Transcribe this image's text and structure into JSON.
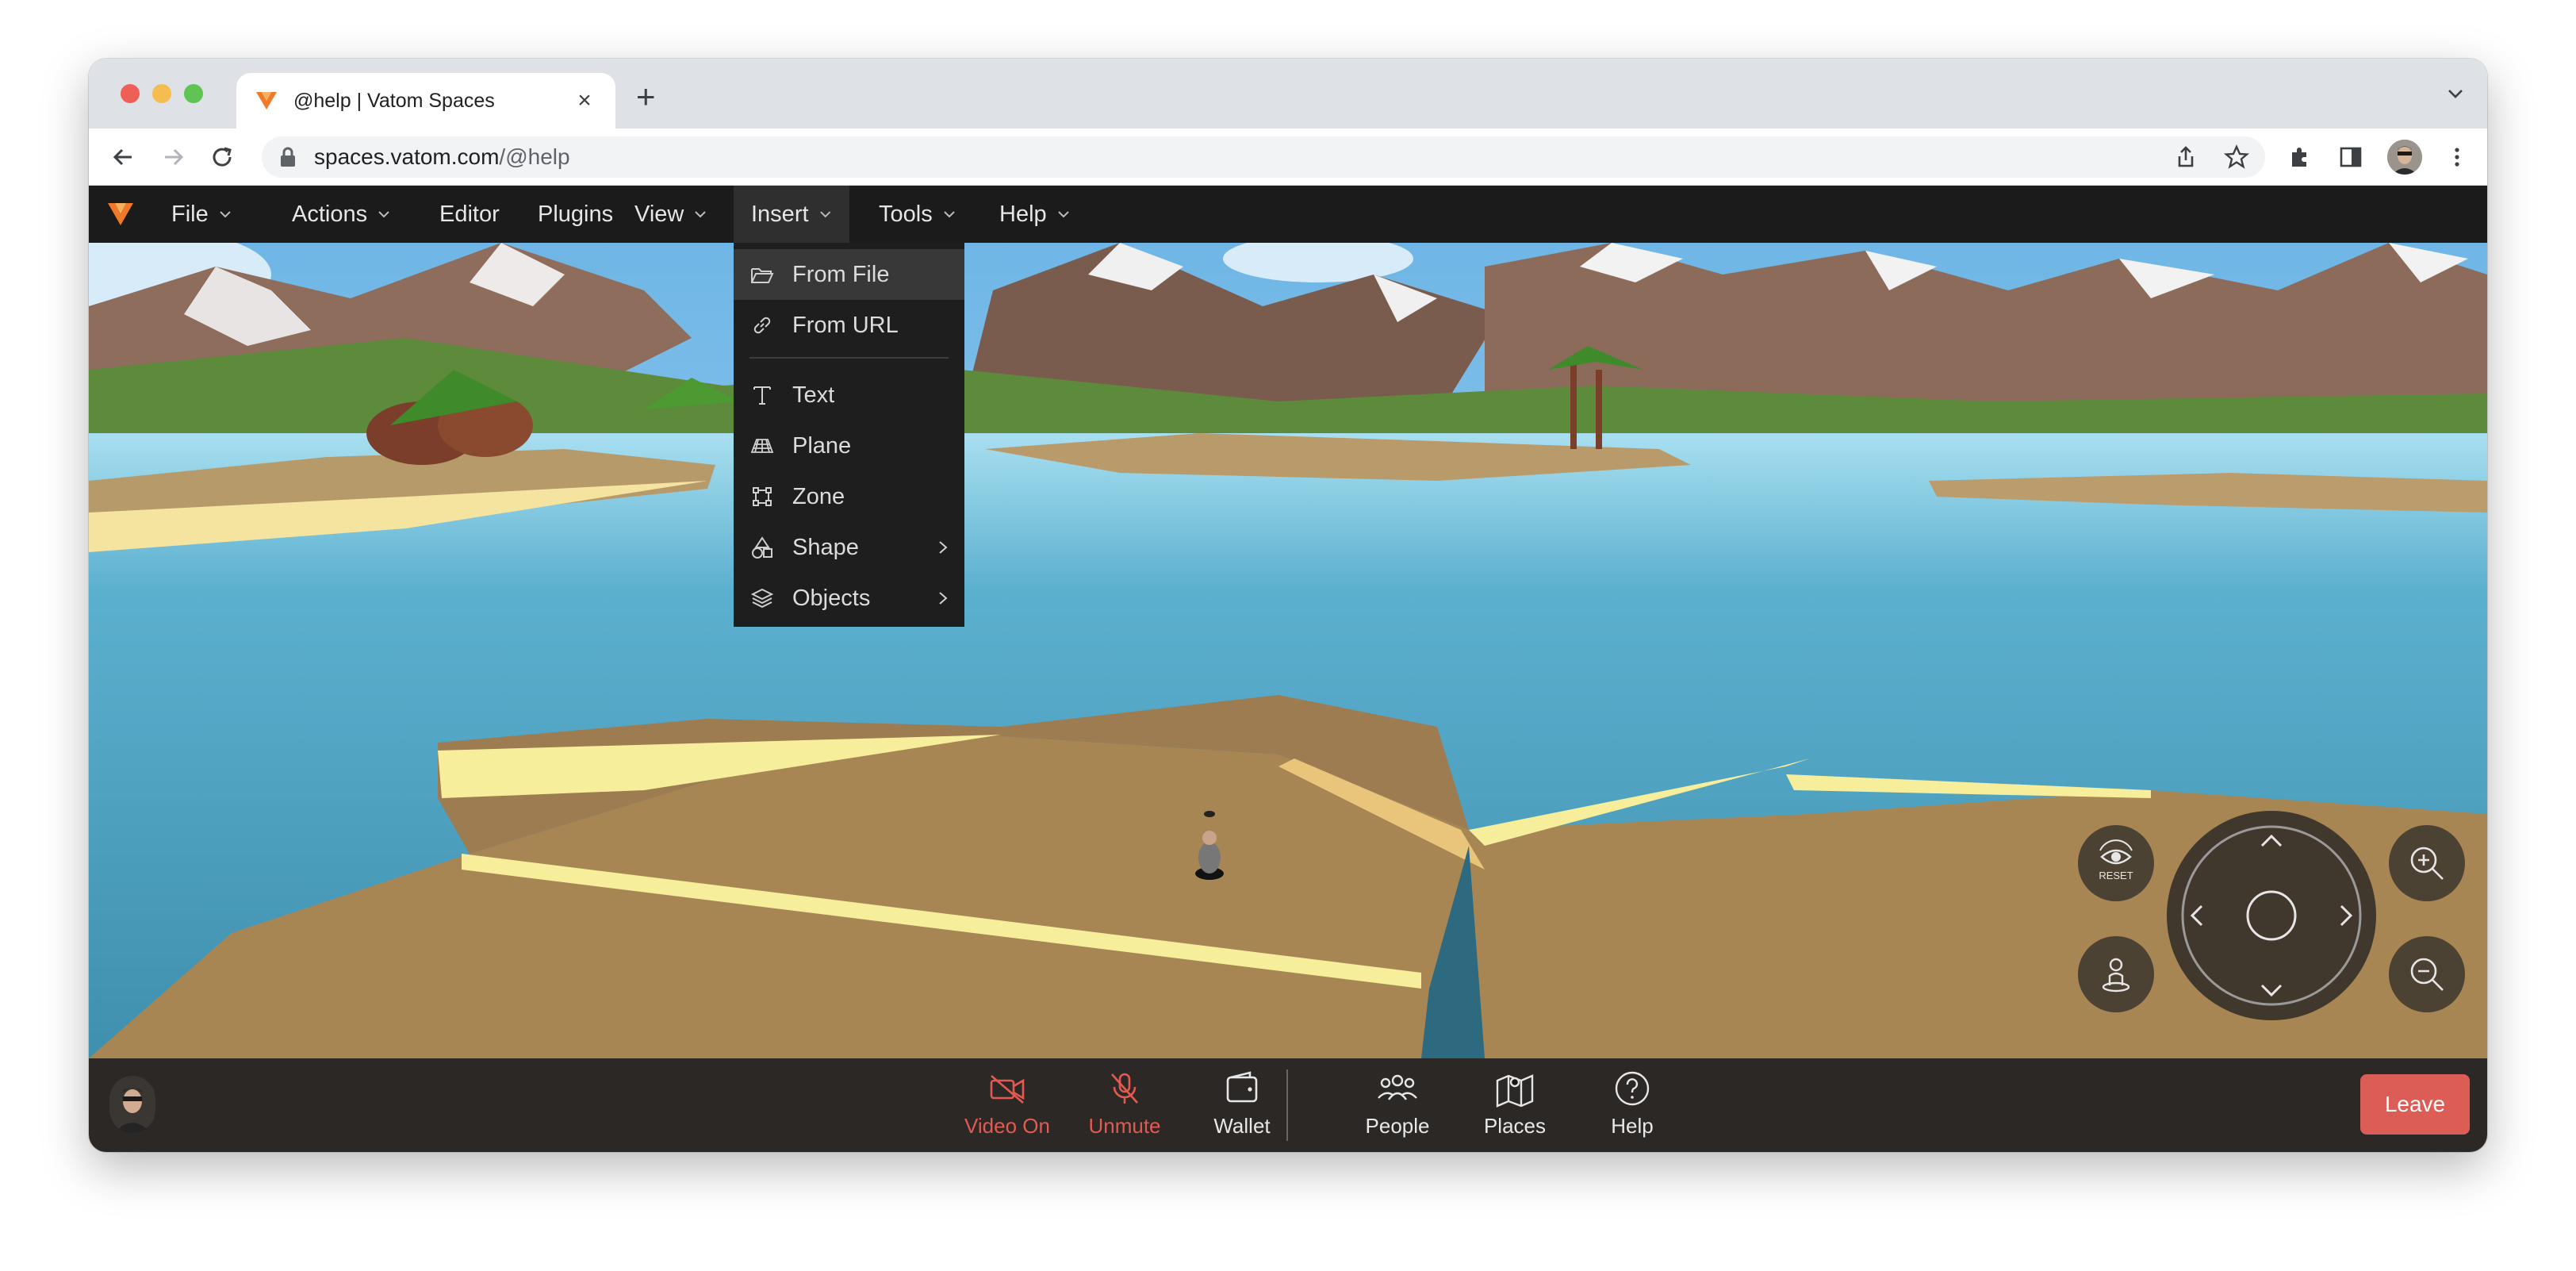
{
  "browser": {
    "tab_title": "@help | Vatom Spaces",
    "new_tab_label": "+",
    "url_host": "spaces.vatom.com",
    "url_path": "/@help"
  },
  "app": {
    "menus": [
      {
        "label": "File",
        "has_dropdown": true
      },
      {
        "label": "Actions",
        "has_dropdown": true
      },
      {
        "label": "Editor",
        "has_dropdown": false
      },
      {
        "label": "Plugins",
        "has_dropdown": false
      },
      {
        "label": "View",
        "has_dropdown": true
      },
      {
        "label": "Insert",
        "has_dropdown": true,
        "active": true
      },
      {
        "label": "Tools",
        "has_dropdown": true
      },
      {
        "label": "Help",
        "has_dropdown": true
      }
    ],
    "insert_menu": [
      {
        "label": "From File",
        "icon": "folder-open-icon",
        "highlighted": true
      },
      {
        "label": "From URL",
        "icon": "link-icon"
      },
      {
        "label": "Text",
        "icon": "text-icon"
      },
      {
        "label": "Plane",
        "icon": "plane-grid-icon"
      },
      {
        "label": "Zone",
        "icon": "zone-icon"
      },
      {
        "label": "Shape",
        "icon": "shapes-icon",
        "submenu": true
      },
      {
        "label": "Objects",
        "icon": "layers-icon",
        "submenu": true
      }
    ]
  },
  "controls": {
    "reset_label": "RESET"
  },
  "bottom_bar": {
    "items": [
      {
        "label": "Video On",
        "icon": "video-off-icon",
        "state_color": "#e45a52"
      },
      {
        "label": "Unmute",
        "icon": "mic-off-icon",
        "state_color": "#e45a52"
      },
      {
        "label": "Wallet",
        "icon": "wallet-icon"
      },
      {
        "label": "People",
        "icon": "people-icon"
      },
      {
        "label": "Places",
        "icon": "map-icon"
      },
      {
        "label": "Help",
        "icon": "help-circle-icon"
      }
    ],
    "leave_label": "Leave"
  },
  "colors": {
    "accent": "#f0792a",
    "danger": "#dc5c56",
    "menubar": "#1b1b1b"
  }
}
